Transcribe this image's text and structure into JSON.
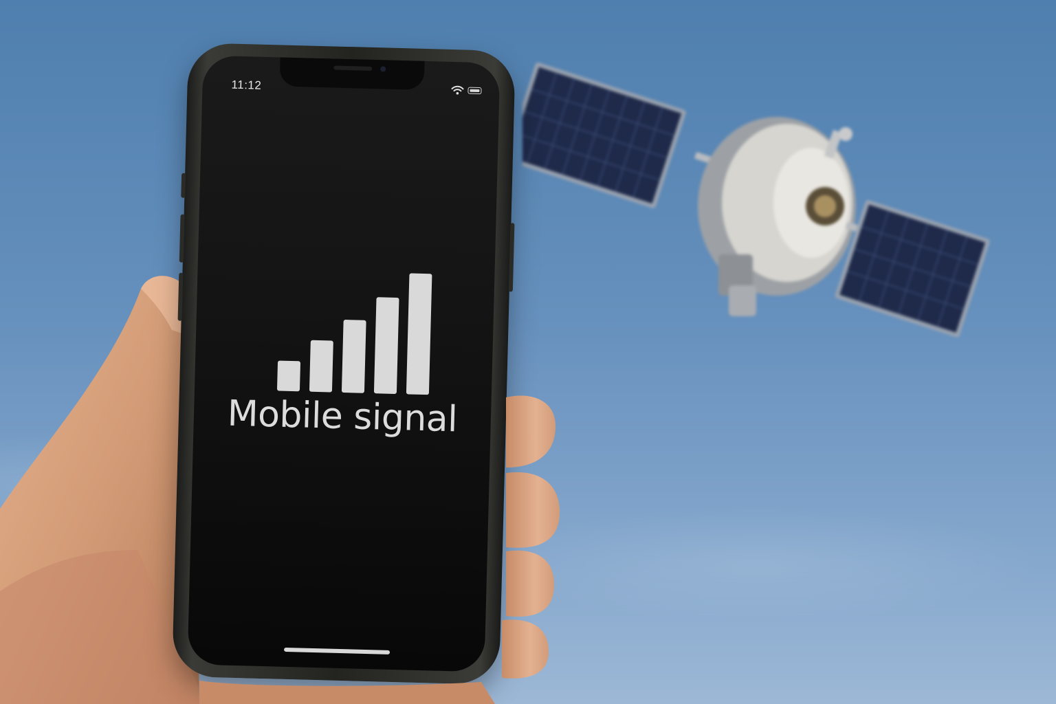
{
  "status_bar": {
    "time": "11:12",
    "icons": [
      "wifi-icon",
      "battery-icon"
    ]
  },
  "screen": {
    "label": "Mobile signal",
    "signal_icon": "signal-bars-icon",
    "signal_level": "5 of 5 bars"
  },
  "colors": {
    "sky": "#6690bd",
    "screen_background": "#141414",
    "screen_text": "#dcdcdc",
    "solar_panel": "#1f2a4a"
  }
}
